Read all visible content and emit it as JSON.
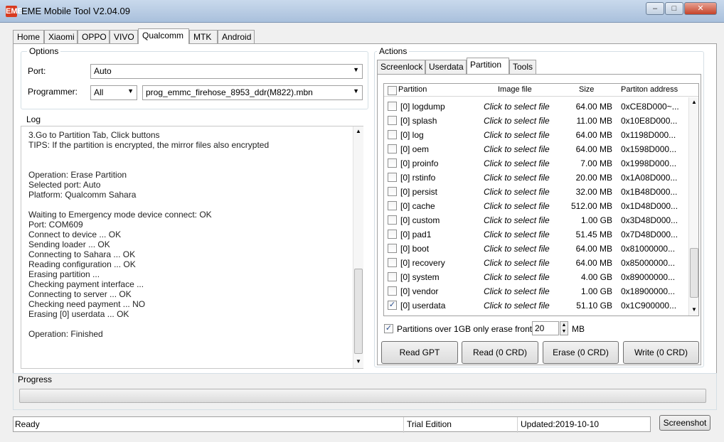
{
  "window": {
    "title": "EME Mobile Tool V2.04.09",
    "app_icon": "EME"
  },
  "tabs": [
    "Home",
    "Xiaomi",
    "OPPO",
    "VIVO",
    "Qualcomm",
    "MTK",
    "Android"
  ],
  "active_tab": "Qualcomm",
  "options": {
    "group_label": "Options",
    "port_label": "Port:",
    "port_value": "Auto",
    "programmer_label": "Programmer:",
    "programmer_filter": "All",
    "programmer_value": "prog_emmc_firehose_8953_ddr(M822).mbn"
  },
  "log": {
    "group_label": "Log",
    "text": "3.Go to Partition Tab, Click buttons\nTIPS: If the partition is encrypted, the mirror files also encrypted\n\n\nOperation: Erase Partition\nSelected port: Auto\nPlatform: Qualcomm Sahara\n\nWaiting to Emergency mode device connect: OK\nPort: COM609\nConnect to device ... OK\nSending loader ... OK\nConnecting to Sahara ... OK\nReading configuration ... OK\nErasing partition ...\nChecking payment interface ...\nConnecting to server ... OK\nChecking need payment ... NO\nErasing [0] userdata ... OK\n\nOperation: Finished"
  },
  "actions": {
    "group_label": "Actions",
    "subtabs": [
      "Screenlock",
      "Userdata",
      "Partition",
      "Tools"
    ],
    "active_subtab": "Partition",
    "columns": {
      "partition": "Partition",
      "image": "Image file",
      "size": "Size",
      "address": "Partiton address"
    },
    "rows": [
      {
        "name": "[0] logdump",
        "image": "Click to select file",
        "size": "64.00 MB",
        "address": "0xCE8D000~...",
        "checked": false
      },
      {
        "name": "[0] splash",
        "image": "Click to select file",
        "size": "11.00 MB",
        "address": "0x10E8D000...",
        "checked": false
      },
      {
        "name": "[0] log",
        "image": "Click to select file",
        "size": "64.00 MB",
        "address": "0x1198D000...",
        "checked": false
      },
      {
        "name": "[0] oem",
        "image": "Click to select file",
        "size": "64.00 MB",
        "address": "0x1598D000...",
        "checked": false
      },
      {
        "name": "[0] proinfo",
        "image": "Click to select file",
        "size": "7.00 MB",
        "address": "0x1998D000...",
        "checked": false
      },
      {
        "name": "[0] rstinfo",
        "image": "Click to select file",
        "size": "20.00 MB",
        "address": "0x1A08D000...",
        "checked": false
      },
      {
        "name": "[0] persist",
        "image": "Click to select file",
        "size": "32.00 MB",
        "address": "0x1B48D000...",
        "checked": false
      },
      {
        "name": "[0] cache",
        "image": "Click to select file",
        "size": "512.00 MB",
        "address": "0x1D48D000...",
        "checked": false
      },
      {
        "name": "[0] custom",
        "image": "Click to select file",
        "size": "1.00 GB",
        "address": "0x3D48D000...",
        "checked": false
      },
      {
        "name": "[0] pad1",
        "image": "Click to select file",
        "size": "51.45 MB",
        "address": "0x7D48D000...",
        "checked": false
      },
      {
        "name": "[0] boot",
        "image": "Click to select file",
        "size": "64.00 MB",
        "address": "0x81000000...",
        "checked": false
      },
      {
        "name": "[0] recovery",
        "image": "Click to select file",
        "size": "64.00 MB",
        "address": "0x85000000...",
        "checked": false
      },
      {
        "name": "[0] system",
        "image": "Click to select file",
        "size": "4.00 GB",
        "address": "0x89000000...",
        "checked": false
      },
      {
        "name": "[0] vendor",
        "image": "Click to select file",
        "size": "1.00 GB",
        "address": "0x18900000...",
        "checked": false
      },
      {
        "name": "[0] userdata",
        "image": "Click to select file",
        "size": "51.10 GB",
        "address": "0x1C900000...",
        "checked": true
      }
    ],
    "erase_front_label": "Partitions over 1GB only erase front",
    "erase_front_value": "20",
    "erase_front_unit": "MB",
    "erase_front_checked": true,
    "buttons": {
      "read_gpt": "Read GPT",
      "read": "Read (0 CRD)",
      "erase": "Erase (0 CRD)",
      "write": "Write (0 CRD)"
    }
  },
  "progress": {
    "label": "Progress",
    "value": 0
  },
  "status": {
    "state": "Ready",
    "edition": "Trial Edition",
    "updated": "Updated:2019-10-10",
    "screenshot": "Screenshot"
  }
}
